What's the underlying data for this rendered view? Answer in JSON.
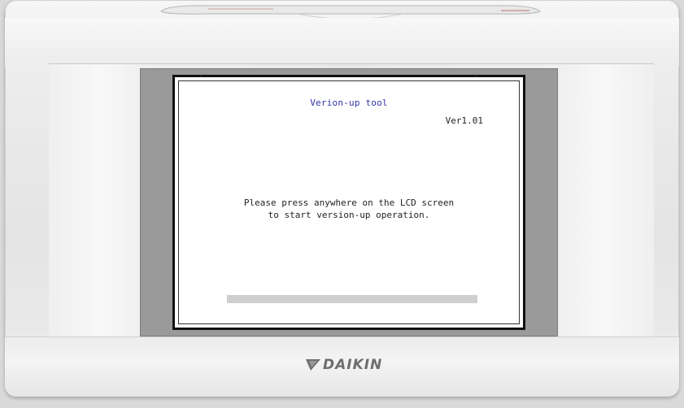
{
  "lcd": {
    "title": "Verion-up tool",
    "version": "Ver1.01",
    "message_line1": "Please press anywhere on the LCD screen",
    "message_line2": "to start version-up operation.",
    "progress": 0
  },
  "brand": {
    "name": "DAIKIN",
    "color": "#6e6e6e"
  },
  "icons": {
    "logo_mark": "daikin-delta-logo-icon"
  }
}
